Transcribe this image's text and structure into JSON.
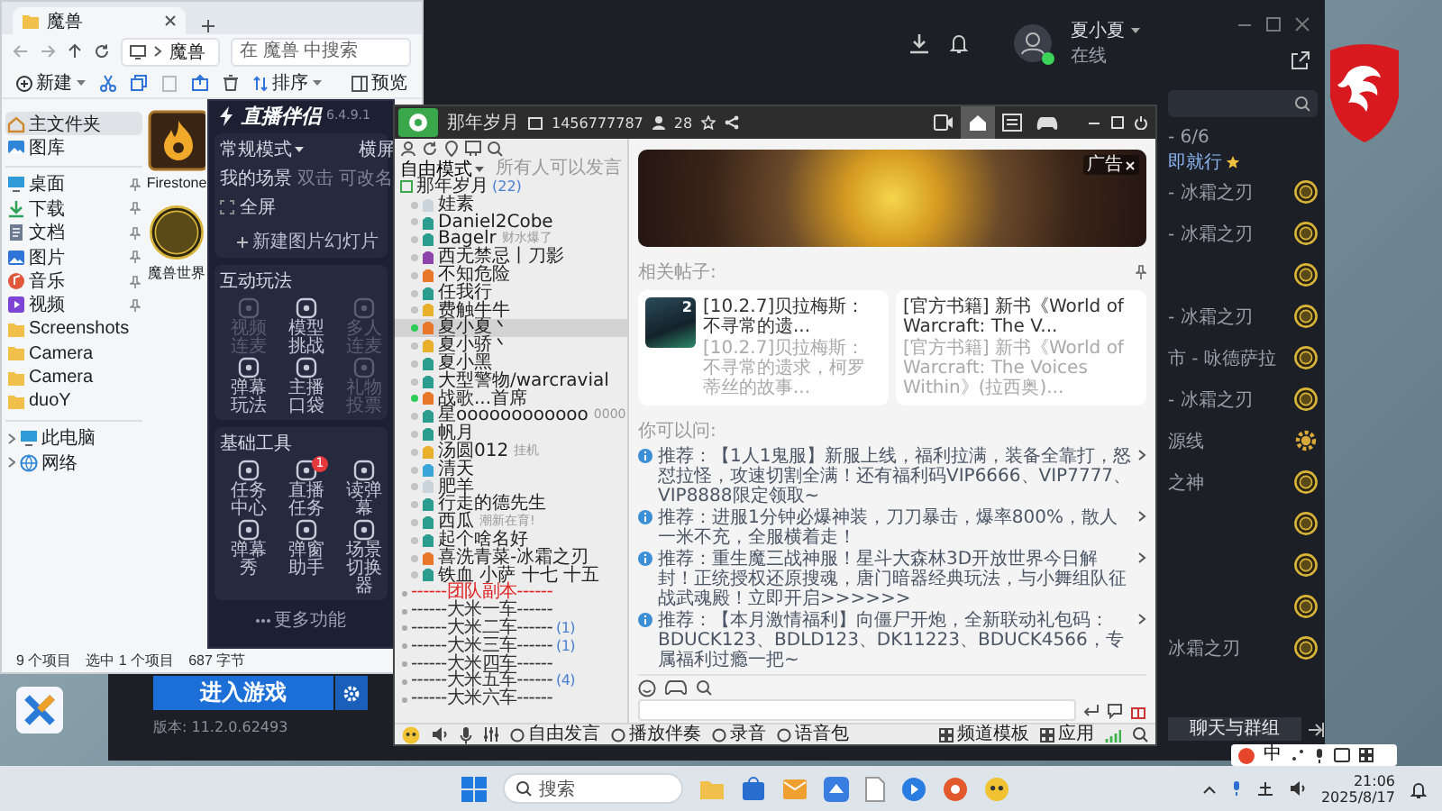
{
  "launcher": {
    "user_name": "夏小夏",
    "status": "在线",
    "list_header": "- 6/6",
    "featured": "即就行",
    "items": [
      {
        "text": "- 冰霜之刃",
        "kind": "realm"
      },
      {
        "text": "- 冰霜之刃",
        "kind": "realm"
      },
      {
        "kind": "realm"
      },
      {
        "text": "- 冰霜之刃",
        "kind": "realm"
      },
      {
        "text": "市 - 咏德萨拉",
        "kind": "realm"
      },
      {
        "text": "- 冰霜之刃",
        "kind": "realm"
      },
      {
        "text": "源线",
        "kind": "event"
      },
      {
        "text": "之神",
        "kind": "realm"
      },
      {
        "kind": "realm"
      },
      {
        "kind": "realm"
      },
      {
        "kind": "realm"
      },
      {
        "text": "冰霜之刃",
        "kind": "realm"
      }
    ],
    "play_button": "进入游戏",
    "version": "版本: 11.2.0.62493",
    "chat_button": "聊天与群组"
  },
  "explorer": {
    "tab": "魔兽",
    "address": "魔兽",
    "search_placeholder": "在 魔兽 中搜索",
    "new_button": "新建",
    "sort_button": "排序",
    "preview_button": "预览",
    "sidebar_sections": [
      [
        {
          "label": "主文件夹",
          "selected": true,
          "pinned": false,
          "expandable": false
        },
        {
          "label": "图库",
          "selected": false,
          "pinned": false,
          "expandable": false
        }
      ],
      [
        {
          "label": "桌面",
          "selected": false,
          "pinned": true,
          "expandable": false
        },
        {
          "label": "下载",
          "selected": false,
          "pinned": true,
          "expandable": false
        },
        {
          "label": "文档",
          "selected": false,
          "pinned": true,
          "expandable": false
        },
        {
          "label": "图片",
          "selected": false,
          "pinned": true,
          "expandable": false
        },
        {
          "label": "音乐",
          "selected": false,
          "pinned": true,
          "expandable": false
        },
        {
          "label": "视频",
          "selected": false,
          "pinned": true,
          "expandable": false
        },
        {
          "label": "Screenshots",
          "selected": false,
          "pinned": false,
          "expandable": false
        },
        {
          "label": "Camera",
          "selected": false,
          "pinned": false,
          "expandable": false
        },
        {
          "label": "Camera",
          "selected": false,
          "pinned": false,
          "expandable": false
        },
        {
          "label": "duoY",
          "selected": false,
          "pinned": false,
          "expandable": false
        }
      ],
      [
        {
          "label": "此电脑",
          "selected": false,
          "pinned": false,
          "expandable": true
        },
        {
          "label": "网络",
          "selected": false,
          "pinned": false,
          "expandable": true
        }
      ]
    ],
    "files": [
      {
        "name": "Firestone"
      },
      {
        "name": "魔兽世界"
      }
    ],
    "status": [
      "9 个项目",
      "选中 1 个项目",
      "687 字节"
    ]
  },
  "streamer": {
    "title": "直播伴侣",
    "version": "6.4.9.1",
    "mode": "常规模式",
    "orientation": "横屏",
    "scenes_label": "我的场景",
    "scenes_hints": [
      "双击",
      "可改名"
    ],
    "scene": "全屏",
    "add_scene": "新建图片幻灯片",
    "sections": [
      {
        "title": "互动玩法",
        "tools": [
          {
            "label": "视频连麦",
            "disabled": true
          },
          {
            "label": "模型挑战",
            "disabled": false
          },
          {
            "label": "多人连麦",
            "disabled": true
          },
          {
            "label": "弹幕玩法",
            "disabled": false
          },
          {
            "label": "主播口袋",
            "disabled": false
          },
          {
            "label": "礼物投票",
            "disabled": true
          }
        ]
      },
      {
        "title": "基础工具",
        "tools": [
          {
            "label": "任务中心",
            "disabled": false
          },
          {
            "label": "直播任务",
            "disabled": false,
            "badge": "1"
          },
          {
            "label": "读弹幕",
            "disabled": false
          },
          {
            "label": "弹幕秀",
            "disabled": false
          },
          {
            "label": "弹窗助手",
            "disabled": false
          },
          {
            "label": "场景切换器",
            "disabled": false
          }
        ]
      }
    ],
    "more": "更多功能"
  },
  "chat": {
    "channel": "那年岁月",
    "room_id": "1456777787",
    "online": "28",
    "nav": [
      {
        "kind": "video",
        "selected": false
      },
      {
        "kind": "home",
        "selected": true
      },
      {
        "kind": "list",
        "selected": false
      },
      {
        "kind": "game",
        "selected": false
      }
    ],
    "mode": "自由模式",
    "speak_rule": "所有人可以发言",
    "tree": [
      {
        "name": "那年岁月",
        "count": "(22)",
        "members": [
          {
            "name": "娃素",
            "color": "#c9d3dc",
            "active": false,
            "selected": false
          },
          {
            "name": "Daniel2Cobe",
            "color": "#2a9d8f",
            "active": false,
            "selected": false
          },
          {
            "name": "Bagelr",
            "note": "财水爆了",
            "color": "#2a9d8f",
            "active": false,
            "selected": false
          },
          {
            "name": "西无禁忌丨刀影",
            "color": "#8e44ad",
            "active": false,
            "selected": false
          },
          {
            "name": "不知危险",
            "color": "#e8762b",
            "active": false,
            "selected": false
          },
          {
            "name": "任我行",
            "color": "#2a9d8f",
            "active": false,
            "selected": false
          },
          {
            "name": "费触牛牛",
            "color": "#e8b02b",
            "active": false,
            "selected": false
          },
          {
            "name": "夏小夏丶",
            "color": "#e8762b",
            "active": true,
            "selected": true
          },
          {
            "name": "夏小骄丶",
            "color": "#e8b02b",
            "active": false,
            "selected": false
          },
          {
            "name": "夏小黑",
            "color": "#2a9d8f",
            "active": false,
            "selected": false
          },
          {
            "name": "大型警物/warcravial",
            "color": "#2a9d8f",
            "active": false,
            "selected": false
          },
          {
            "name": "战歌...首席",
            "color": "#e8762b",
            "active": true,
            "selected": false
          },
          {
            "name": "星oooooooooooo",
            "note": "0000",
            "color": "#2a9d8f",
            "active": false,
            "selected": false
          },
          {
            "name": "帆月",
            "color": "#2a9d8f",
            "active": false,
            "selected": false
          },
          {
            "name": "汤圆012",
            "note": "挂机",
            "color": "#e8b02b",
            "active": false,
            "selected": false
          },
          {
            "name": "清天",
            "color": "#3aa6d8",
            "active": false,
            "selected": false
          },
          {
            "name": "肥羊",
            "color": "#c9d3dc",
            "active": false,
            "selected": false
          },
          {
            "name": "行走的德先生",
            "color": "#2a9d8f",
            "active": false,
            "selected": false
          },
          {
            "name": "西瓜",
            "note": "潮新在育!",
            "color": "#2a9d8f",
            "active": false,
            "selected": false
          },
          {
            "name": "起个啥名好",
            "color": "#2a9d8f",
            "active": false,
            "selected": false
          },
          {
            "name": "喜洗青菜-冰霜之刃",
            "color": "#e8762b",
            "active": false,
            "selected": false
          },
          {
            "name": "铁血 小萨 十七 十五",
            "color": "#2a9d8f",
            "active": false,
            "selected": false
          }
        ]
      }
    ],
    "channels": [
      {
        "name": "------团队副本------",
        "color": "#e02424"
      },
      {
        "name": "------大米一车------",
        "color": "#333333"
      },
      {
        "name": "------大米二车------",
        "count": "(1)",
        "color": "#333333"
      },
      {
        "name": "------大米三车------",
        "count": "(1)",
        "color": "#333333"
      },
      {
        "name": "------大米四车------",
        "color": "#333333"
      },
      {
        "name": "------大米五车------",
        "count": "(4)",
        "color": "#333333"
      },
      {
        "name": "------大米六车------",
        "color": "#333333"
      }
    ],
    "ad_label": "广告",
    "related_title": "相关帖子:",
    "posts": [
      {
        "title": "[10.2.7]贝拉梅斯：不寻常的遗...",
        "summary": "[10.2.7]贝拉梅斯：不寻常的遗求，柯罗蒂丝的故事...",
        "thumb_badge": "2"
      },
      {
        "title": "[官方书籍] 新书《World of Warcraft: The V...",
        "summary": "[官方书籍] 新书《World of Warcraft: The Voices Within》(拉西奥)..."
      }
    ],
    "ask_title": "你可以问:",
    "suggestions": [
      "推荐：【1人1鬼服】新服上线，福利拉满，装备全靠打，怒怼拉怪，攻速切割全满！还有福利码VIP6666、VIP7777、VIP8888限定领取~",
      "推荐：进服1分钟必爆神装，刀刀暴击，爆率800%，散人一米不充，全服横着走！",
      "推荐：重生魔三战神服！星斗大森林3D开放世界今日解封！正统授权还原搜魂，唐门暗器经典玩法，与小舞组队征战武魂殿！立即开启>>>>>>",
      "推荐：【本月激情福利】向僵尸开炮，全新联动礼包码：BDUCK123、BDLD123、DK11223、BDUCK4566，专属福利过瘾一把~"
    ],
    "bottom_left": [
      "自由发言",
      "播放伴奏",
      "录音",
      "语音包"
    ],
    "bottom_right": [
      "频道模板",
      "应用"
    ]
  },
  "ime": {
    "mode": "中"
  },
  "taskbar": {
    "search": "搜索",
    "time": "21:06",
    "date": "2025/8/17"
  }
}
